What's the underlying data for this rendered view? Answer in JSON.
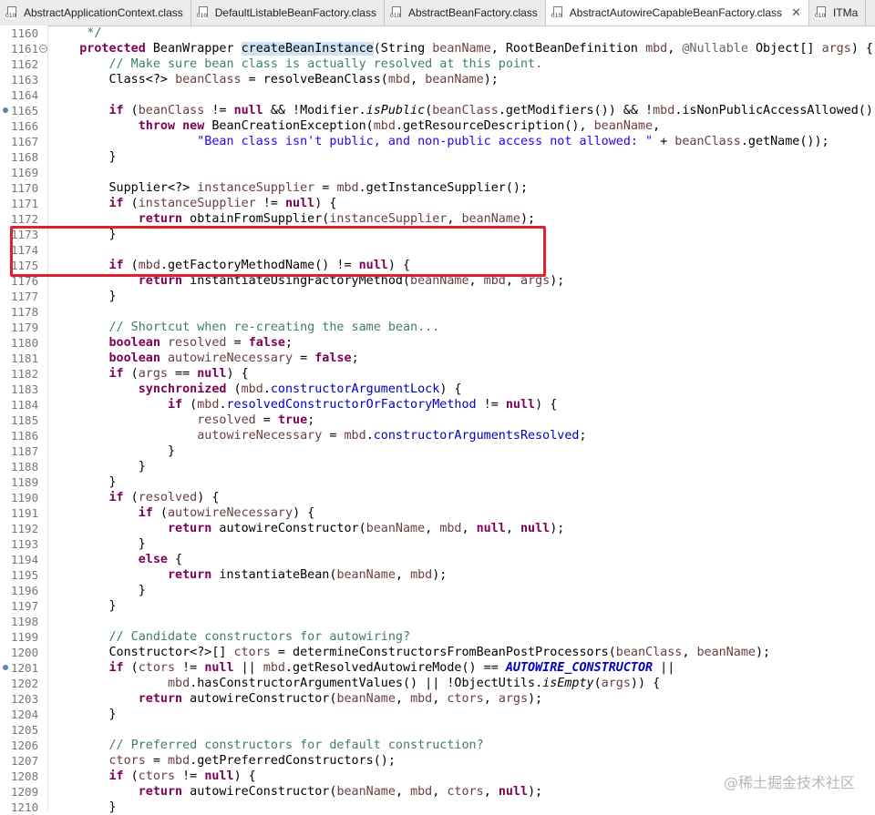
{
  "tabs": [
    {
      "label": "AbstractApplicationContext.class",
      "active": false
    },
    {
      "label": "DefaultListableBeanFactory.class",
      "active": false
    },
    {
      "label": "AbstractBeanFactory.class",
      "active": false
    },
    {
      "label": "AbstractAutowireCapableBeanFactory.class",
      "active": true
    },
    {
      "label": "ITMa",
      "active": false
    }
  ],
  "close_glyph": "✕",
  "icon_text": "010",
  "lines": [
    {
      "n": "1160",
      "tokens": [
        [
          "     */",
          "cm"
        ]
      ]
    },
    {
      "n": "1161",
      "fold": "−",
      "tokens": [
        [
          "    ",
          ""
        ],
        [
          "protected",
          "kw"
        ],
        [
          " BeanWrapper ",
          ""
        ],
        [
          "createBeanInstance",
          "hl"
        ],
        [
          "(String ",
          ""
        ],
        [
          "beanName",
          "pv"
        ],
        [
          ", RootBeanDefinition ",
          ""
        ],
        [
          "mbd",
          "pv"
        ],
        [
          ", ",
          ""
        ],
        [
          "@Nullable",
          "an"
        ],
        [
          " Object[] ",
          ""
        ],
        [
          "args",
          "pv"
        ],
        [
          ") {",
          ""
        ]
      ]
    },
    {
      "n": "1162",
      "tokens": [
        [
          "        ",
          ""
        ],
        [
          "// Make sure bean class is actually resolved at this point.",
          "cm"
        ]
      ]
    },
    {
      "n": "1163",
      "tokens": [
        [
          "        Class<?> ",
          ""
        ],
        [
          "beanClass",
          "pv"
        ],
        [
          " = resolveBeanClass(",
          ""
        ],
        [
          "mbd",
          "pv"
        ],
        [
          ", ",
          ""
        ],
        [
          "beanName",
          "pv"
        ],
        [
          ");",
          ""
        ]
      ]
    },
    {
      "n": "1164",
      "tokens": []
    },
    {
      "n": "1165",
      "marker": true,
      "tokens": [
        [
          "        ",
          ""
        ],
        [
          "if",
          "kw"
        ],
        [
          " (",
          ""
        ],
        [
          "beanClass",
          "pv"
        ],
        [
          " != ",
          ""
        ],
        [
          "null",
          "kw"
        ],
        [
          " && !Modifier.",
          ""
        ],
        [
          "isPublic",
          "it"
        ],
        [
          "(",
          ""
        ],
        [
          "beanClass",
          "pv"
        ],
        [
          ".getModifiers()) && !",
          ""
        ],
        [
          "mbd",
          "pv"
        ],
        [
          ".isNonPublicAccessAllowed()) {",
          ""
        ]
      ]
    },
    {
      "n": "1166",
      "tokens": [
        [
          "            ",
          ""
        ],
        [
          "throw",
          "kw"
        ],
        [
          " ",
          ""
        ],
        [
          "new",
          "kw"
        ],
        [
          " BeanCreationException(",
          ""
        ],
        [
          "mbd",
          "pv"
        ],
        [
          ".getResourceDescription(), ",
          ""
        ],
        [
          "beanName",
          "pv"
        ],
        [
          ",",
          ""
        ]
      ]
    },
    {
      "n": "1167",
      "tokens": [
        [
          "                    ",
          ""
        ],
        [
          "\"Bean class isn't public, and non-public access not allowed: \"",
          "st"
        ],
        [
          " + ",
          ""
        ],
        [
          "beanClass",
          "pv"
        ],
        [
          ".getName());",
          ""
        ]
      ]
    },
    {
      "n": "1168",
      "tokens": [
        [
          "        }",
          ""
        ]
      ]
    },
    {
      "n": "1169",
      "tokens": []
    },
    {
      "n": "1170",
      "tokens": [
        [
          "        Supplier<?> ",
          ""
        ],
        [
          "instanceSupplier",
          "pv"
        ],
        [
          " = ",
          ""
        ],
        [
          "mbd",
          "pv"
        ],
        [
          ".getInstanceSupplier();",
          ""
        ]
      ]
    },
    {
      "n": "1171",
      "tokens": [
        [
          "        ",
          ""
        ],
        [
          "if",
          "kw"
        ],
        [
          " (",
          ""
        ],
        [
          "instanceSupplier",
          "pv"
        ],
        [
          " != ",
          ""
        ],
        [
          "null",
          "kw"
        ],
        [
          ") {",
          ""
        ]
      ]
    },
    {
      "n": "1172",
      "tokens": [
        [
          "            ",
          ""
        ],
        [
          "return",
          "kw"
        ],
        [
          " obtainFromSupplier(",
          ""
        ],
        [
          "instanceSupplier",
          "pv"
        ],
        [
          ", ",
          ""
        ],
        [
          "beanName",
          "pv"
        ],
        [
          ");",
          ""
        ]
      ]
    },
    {
      "n": "1173",
      "tokens": [
        [
          "        }",
          ""
        ]
      ]
    },
    {
      "n": "1174",
      "tokens": []
    },
    {
      "n": "1175",
      "tokens": [
        [
          "        ",
          ""
        ],
        [
          "if",
          "kw"
        ],
        [
          " (",
          ""
        ],
        [
          "mbd",
          "pv"
        ],
        [
          ".getFactoryMethodName() != ",
          ""
        ],
        [
          "null",
          "kw"
        ],
        [
          ") {",
          ""
        ]
      ]
    },
    {
      "n": "1176",
      "tokens": [
        [
          "            ",
          ""
        ],
        [
          "return",
          "kw"
        ],
        [
          " instantiateUsingFactoryMethod(",
          ""
        ],
        [
          "beanName",
          "pv"
        ],
        [
          ", ",
          ""
        ],
        [
          "mbd",
          "pv"
        ],
        [
          ", ",
          ""
        ],
        [
          "args",
          "pv"
        ],
        [
          ");",
          ""
        ]
      ]
    },
    {
      "n": "1177",
      "tokens": [
        [
          "        }",
          ""
        ]
      ]
    },
    {
      "n": "1178",
      "tokens": []
    },
    {
      "n": "1179",
      "tokens": [
        [
          "        ",
          ""
        ],
        [
          "// Shortcut when re-creating the same bean...",
          "cm"
        ]
      ]
    },
    {
      "n": "1180",
      "tokens": [
        [
          "        ",
          ""
        ],
        [
          "boolean",
          "kw"
        ],
        [
          " ",
          ""
        ],
        [
          "resolved",
          "pv"
        ],
        [
          " = ",
          ""
        ],
        [
          "false",
          "kw"
        ],
        [
          ";",
          ""
        ]
      ]
    },
    {
      "n": "1181",
      "tokens": [
        [
          "        ",
          ""
        ],
        [
          "boolean",
          "kw"
        ],
        [
          " ",
          ""
        ],
        [
          "autowireNecessary",
          "pv"
        ],
        [
          " = ",
          ""
        ],
        [
          "false",
          "kw"
        ],
        [
          ";",
          ""
        ]
      ]
    },
    {
      "n": "1182",
      "tokens": [
        [
          "        ",
          ""
        ],
        [
          "if",
          "kw"
        ],
        [
          " (",
          ""
        ],
        [
          "args",
          "pv"
        ],
        [
          " == ",
          ""
        ],
        [
          "null",
          "kw"
        ],
        [
          ") {",
          ""
        ]
      ]
    },
    {
      "n": "1183",
      "tokens": [
        [
          "            ",
          ""
        ],
        [
          "synchronized",
          "kw"
        ],
        [
          " (",
          ""
        ],
        [
          "mbd",
          "pv"
        ],
        [
          ".",
          ""
        ],
        [
          "constructorArgumentLock",
          "fd"
        ],
        [
          ") {",
          ""
        ]
      ]
    },
    {
      "n": "1184",
      "tokens": [
        [
          "                ",
          ""
        ],
        [
          "if",
          "kw"
        ],
        [
          " (",
          ""
        ],
        [
          "mbd",
          "pv"
        ],
        [
          ".",
          ""
        ],
        [
          "resolvedConstructorOrFactoryMethod",
          "fd"
        ],
        [
          " != ",
          ""
        ],
        [
          "null",
          "kw"
        ],
        [
          ") {",
          ""
        ]
      ]
    },
    {
      "n": "1185",
      "tokens": [
        [
          "                    ",
          ""
        ],
        [
          "resolved",
          "pv"
        ],
        [
          " = ",
          ""
        ],
        [
          "true",
          "kw"
        ],
        [
          ";",
          ""
        ]
      ]
    },
    {
      "n": "1186",
      "tokens": [
        [
          "                    ",
          ""
        ],
        [
          "autowireNecessary",
          "pv"
        ],
        [
          " = ",
          ""
        ],
        [
          "mbd",
          "pv"
        ],
        [
          ".",
          ""
        ],
        [
          "constructorArgumentsResolved",
          "fd"
        ],
        [
          ";",
          ""
        ]
      ]
    },
    {
      "n": "1187",
      "tokens": [
        [
          "                }",
          ""
        ]
      ]
    },
    {
      "n": "1188",
      "tokens": [
        [
          "            }",
          ""
        ]
      ]
    },
    {
      "n": "1189",
      "tokens": [
        [
          "        }",
          ""
        ]
      ]
    },
    {
      "n": "1190",
      "tokens": [
        [
          "        ",
          ""
        ],
        [
          "if",
          "kw"
        ],
        [
          " (",
          ""
        ],
        [
          "resolved",
          "pv"
        ],
        [
          ") {",
          ""
        ]
      ]
    },
    {
      "n": "1191",
      "tokens": [
        [
          "            ",
          ""
        ],
        [
          "if",
          "kw"
        ],
        [
          " (",
          ""
        ],
        [
          "autowireNecessary",
          "pv"
        ],
        [
          ") {",
          ""
        ]
      ]
    },
    {
      "n": "1192",
      "tokens": [
        [
          "                ",
          ""
        ],
        [
          "return",
          "kw"
        ],
        [
          " autowireConstructor(",
          ""
        ],
        [
          "beanName",
          "pv"
        ],
        [
          ", ",
          ""
        ],
        [
          "mbd",
          "pv"
        ],
        [
          ", ",
          ""
        ],
        [
          "null",
          "kw"
        ],
        [
          ", ",
          ""
        ],
        [
          "null",
          "kw"
        ],
        [
          ");",
          ""
        ]
      ]
    },
    {
      "n": "1193",
      "tokens": [
        [
          "            }",
          ""
        ]
      ]
    },
    {
      "n": "1194",
      "tokens": [
        [
          "            ",
          ""
        ],
        [
          "else",
          "kw"
        ],
        [
          " {",
          ""
        ]
      ]
    },
    {
      "n": "1195",
      "tokens": [
        [
          "                ",
          ""
        ],
        [
          "return",
          "kw"
        ],
        [
          " instantiateBean(",
          ""
        ],
        [
          "beanName",
          "pv"
        ],
        [
          ", ",
          ""
        ],
        [
          "mbd",
          "pv"
        ],
        [
          ");",
          ""
        ]
      ]
    },
    {
      "n": "1196",
      "tokens": [
        [
          "            }",
          ""
        ]
      ]
    },
    {
      "n": "1197",
      "tokens": [
        [
          "        }",
          ""
        ]
      ]
    },
    {
      "n": "1198",
      "tokens": []
    },
    {
      "n": "1199",
      "tokens": [
        [
          "        ",
          ""
        ],
        [
          "// Candidate constructors for autowiring?",
          "cm"
        ]
      ]
    },
    {
      "n": "1200",
      "tokens": [
        [
          "        Constructor<?>[] ",
          ""
        ],
        [
          "ctors",
          "pv"
        ],
        [
          " = determineConstructorsFromBeanPostProcessors(",
          ""
        ],
        [
          "beanClass",
          "pv"
        ],
        [
          ", ",
          ""
        ],
        [
          "beanName",
          "pv"
        ],
        [
          ");",
          ""
        ]
      ]
    },
    {
      "n": "1201",
      "marker": true,
      "tokens": [
        [
          "        ",
          ""
        ],
        [
          "if",
          "kw"
        ],
        [
          " (",
          ""
        ],
        [
          "ctors",
          "pv"
        ],
        [
          " != ",
          ""
        ],
        [
          "null",
          "kw"
        ],
        [
          " || ",
          ""
        ],
        [
          "mbd",
          "pv"
        ],
        [
          ".getResolvedAutowireMode() == ",
          ""
        ],
        [
          "AUTOWIRE_CONSTRUCTOR",
          "sf"
        ],
        [
          " ||",
          ""
        ]
      ]
    },
    {
      "n": "1202",
      "tokens": [
        [
          "                ",
          ""
        ],
        [
          "mbd",
          "pv"
        ],
        [
          ".hasConstructorArgumentValues() || !ObjectUtils.",
          ""
        ],
        [
          "isEmpty",
          "it"
        ],
        [
          "(",
          ""
        ],
        [
          "args",
          "pv"
        ],
        [
          ")) {",
          ""
        ]
      ]
    },
    {
      "n": "1203",
      "tokens": [
        [
          "            ",
          ""
        ],
        [
          "return",
          "kw"
        ],
        [
          " autowireConstructor(",
          ""
        ],
        [
          "beanName",
          "pv"
        ],
        [
          ", ",
          ""
        ],
        [
          "mbd",
          "pv"
        ],
        [
          ", ",
          ""
        ],
        [
          "ctors",
          "pv"
        ],
        [
          ", ",
          ""
        ],
        [
          "args",
          "pv"
        ],
        [
          ");",
          ""
        ]
      ]
    },
    {
      "n": "1204",
      "tokens": [
        [
          "        }",
          ""
        ]
      ]
    },
    {
      "n": "1205",
      "tokens": []
    },
    {
      "n": "1206",
      "tokens": [
        [
          "        ",
          ""
        ],
        [
          "// Preferred constructors for default construction?",
          "cm"
        ]
      ]
    },
    {
      "n": "1207",
      "tokens": [
        [
          "        ",
          ""
        ],
        [
          "ctors",
          "pv"
        ],
        [
          " = ",
          ""
        ],
        [
          "mbd",
          "pv"
        ],
        [
          ".getPreferredConstructors();",
          ""
        ]
      ]
    },
    {
      "n": "1208",
      "tokens": [
        [
          "        ",
          ""
        ],
        [
          "if",
          "kw"
        ],
        [
          " (",
          ""
        ],
        [
          "ctors",
          "pv"
        ],
        [
          " != ",
          ""
        ],
        [
          "null",
          "kw"
        ],
        [
          ") {",
          ""
        ]
      ]
    },
    {
      "n": "1209",
      "tokens": [
        [
          "            ",
          ""
        ],
        [
          "return",
          "kw"
        ],
        [
          " autowireConstructor(",
          ""
        ],
        [
          "beanName",
          "pv"
        ],
        [
          ", ",
          ""
        ],
        [
          "mbd",
          "pv"
        ],
        [
          ", ",
          ""
        ],
        [
          "ctors",
          "pv"
        ],
        [
          ", ",
          ""
        ],
        [
          "null",
          "kw"
        ],
        [
          ");",
          ""
        ]
      ]
    },
    {
      "n": "1210",
      "tokens": [
        [
          "        }",
          ""
        ]
      ]
    }
  ],
  "watermark": "@稀土掘金技术社区"
}
